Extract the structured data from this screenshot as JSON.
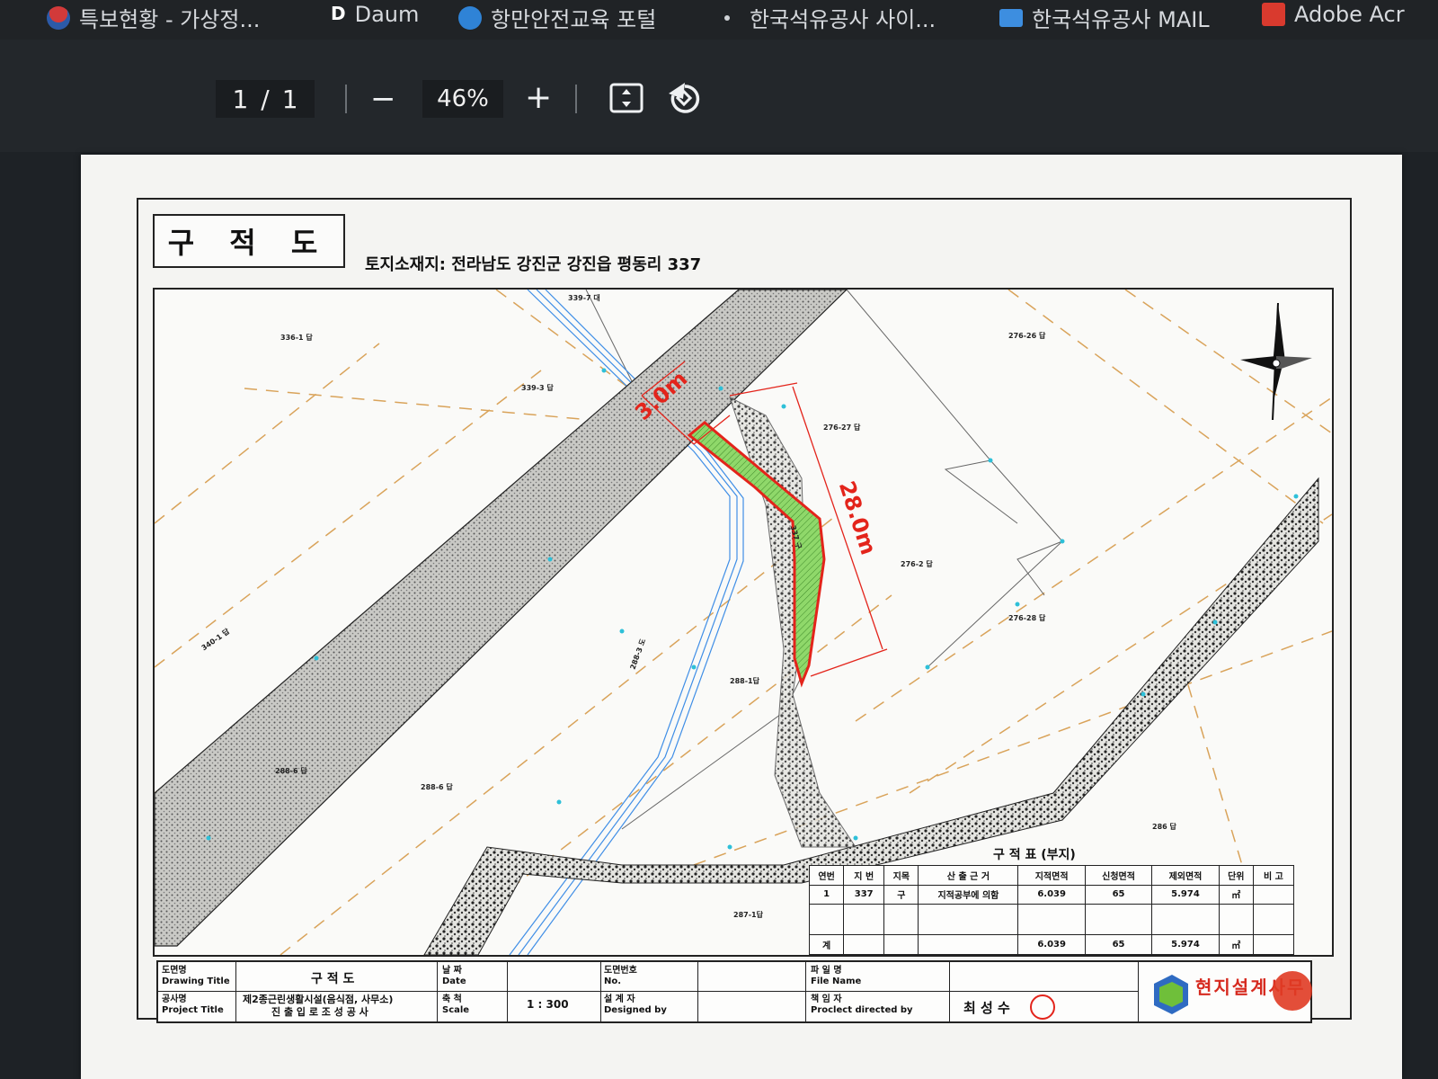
{
  "bookmarks": [
    {
      "label": "특보현황 - 가상정...",
      "icon": "taegeuk-icon",
      "color": "#c63b3b"
    },
    {
      "label": "Daum",
      "icon": "daum-icon",
      "color": "#ffffff"
    },
    {
      "label": "항만안전교육 포털",
      "icon": "globe-icon",
      "color": "#2f83d6"
    },
    {
      "label": "한국석유공사 사이...",
      "icon": "dot-icon",
      "color": "#cfd3d7"
    },
    {
      "label": "한국석유공사 MAIL",
      "icon": "mail-icon",
      "color": "#3d8ee0"
    },
    {
      "label": "Adobe Acr",
      "icon": "pdf-icon",
      "color": "#d93a2e"
    }
  ],
  "toolbar": {
    "page_current": "1",
    "page_separator": "/",
    "page_total": "1",
    "zoom_out": "−",
    "zoom_level": "46%",
    "zoom_in": "+"
  },
  "drawing": {
    "title": "구 적 도",
    "location": "토지소재지:  전라남도 강진군 강진읍 평동리 337",
    "dimension_short": "3.0m",
    "dimension_long": "28.0m",
    "lot_labels": [
      {
        "text": "339-7 대"
      },
      {
        "text": "336-1 답"
      },
      {
        "text": "339-3 답"
      },
      {
        "text": "276-26 답"
      },
      {
        "text": "276-27 답"
      },
      {
        "text": "276-2 답"
      },
      {
        "text": "276-28 답"
      },
      {
        "text": "340-1 답"
      },
      {
        "text": "288-1답"
      },
      {
        "text": "288-6 답"
      },
      {
        "text": "288-6 답"
      },
      {
        "text": "287-1답"
      },
      {
        "text": "286 답"
      },
      {
        "text": "337 구"
      },
      {
        "text": "288-3 도"
      }
    ]
  },
  "area_table": {
    "title": "구 적 표 (부지)",
    "headers": [
      "연번",
      "지 번",
      "지목",
      "산 출 근 거",
      "지적면적",
      "신청면적",
      "제외면적",
      "단위",
      "비 고"
    ],
    "rows": [
      [
        "1",
        "337",
        "구",
        "지적공부에 의함",
        "6.039",
        "65",
        "5.974",
        "㎡",
        ""
      ],
      [
        "",
        "",
        "",
        "",
        "",
        "",
        "",
        "",
        ""
      ],
      [
        "계",
        "",
        "",
        "",
        "6.039",
        "65",
        "5.974",
        "㎡",
        ""
      ]
    ]
  },
  "title_block": {
    "drawing_title_label_ko": "도면명",
    "drawing_title_label_en": "Drawing Title",
    "drawing_title_value": "구 적 도",
    "project_title_label_ko": "공사명",
    "project_title_label_en": "Project Title",
    "project_title_value_1": "제2종근린생활시설(음식점, 사무소)",
    "project_title_value_2": "진 출 입 로 조 성 공 사",
    "date_label_ko": "날 짜",
    "date_label_en": "Date",
    "scale_label_ko": "축 척",
    "scale_label_en": "Scale",
    "scale_value": "1 : 300",
    "no_label_ko": "도면번호",
    "no_label_en": "No.",
    "designed_label_ko": "설 계 자",
    "designed_label_en": "Designed by",
    "file_label_ko": "파 일 명",
    "file_label_en": "File Name",
    "directed_label_ko": "책 임 자",
    "directed_label_en": "Proclect directed by",
    "signature_name": "최 성 수",
    "company_name": "현지설계사무"
  },
  "colors": {
    "highlight_green": "#7ad24a",
    "outline_red": "#e3241b",
    "road_grey": "#b8b8b4",
    "parcel_orange": "#d9a35a",
    "pipe_blue": "#3f8ee6"
  }
}
